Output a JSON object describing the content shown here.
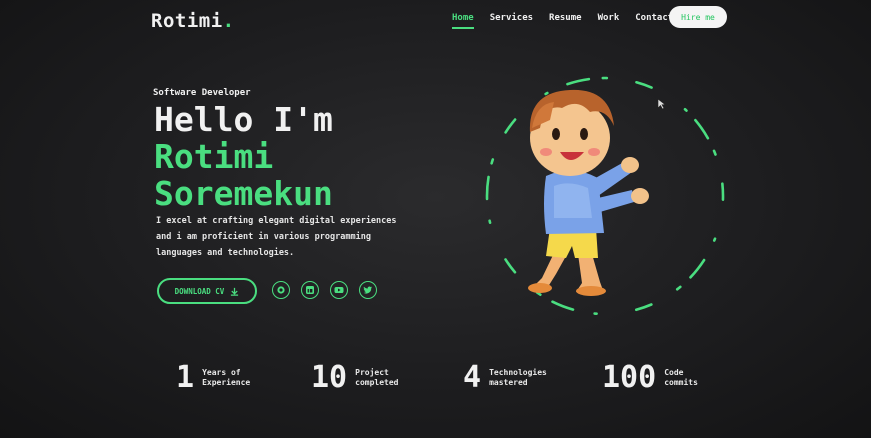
{
  "brand": {
    "name": "Rotimi",
    "dot": "."
  },
  "nav": {
    "items": [
      "Home",
      "Services",
      "Resume",
      "Work",
      "Contact"
    ],
    "active": "Home",
    "hire_label": "Hire me"
  },
  "hero": {
    "role": "Software Developer",
    "greeting": "Hello I'm",
    "first_name": "Rotimi",
    "last_name": "Soremekun",
    "description": "I excel at crafting elegant digital experiences and i am proficient in various programming languages and technologies.",
    "cv_label": "DOWNLOAD CV",
    "socials": [
      "github-icon",
      "linkedin-icon",
      "youtube-icon",
      "twitter-icon"
    ]
  },
  "stats": [
    {
      "value": "1",
      "label": "Years of\nExperience"
    },
    {
      "value": "10",
      "label": "Project\ncompleted"
    },
    {
      "value": "4",
      "label": "Technologies\nmastered"
    },
    {
      "value": "100",
      "label": "Code\ncommits"
    }
  ],
  "colors": {
    "accent": "#4ade80",
    "background": "#1d1d1f",
    "text": "#f1f1f1"
  }
}
